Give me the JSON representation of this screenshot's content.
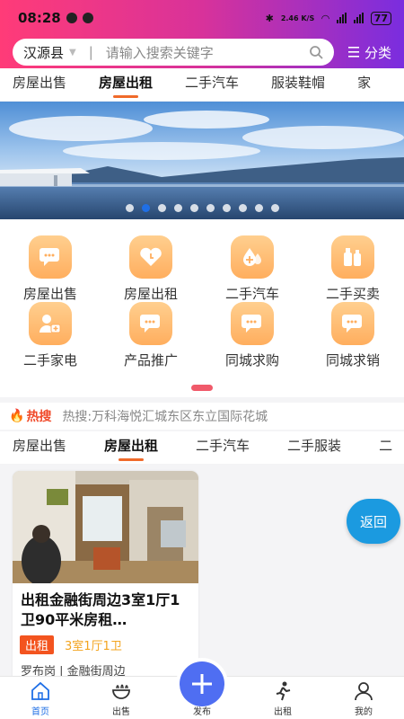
{
  "status_bar": {
    "time": "08:28",
    "network_speed": "2.46 K/S",
    "battery": "77"
  },
  "search": {
    "city": "汉源县",
    "placeholder": "请输入搜索关键字",
    "category_label": "分类"
  },
  "top_tabs": [
    {
      "label": "房屋出售",
      "active": false
    },
    {
      "label": "房屋出租",
      "active": true
    },
    {
      "label": "二手汽车",
      "active": false
    },
    {
      "label": "服装鞋帽",
      "active": false
    },
    {
      "label": "家",
      "active": false
    }
  ],
  "banner": {
    "dots": 10,
    "active_dot": 1
  },
  "grid": {
    "items": [
      {
        "label": "房屋出售",
        "icon": "chat-bubbles-icon"
      },
      {
        "label": "房屋出租",
        "icon": "heart-clock-icon"
      },
      {
        "label": "二手汽车",
        "icon": "droplet-plus-icon"
      },
      {
        "label": "二手买卖",
        "icon": "bottles-icon"
      },
      {
        "label": "二手家电",
        "icon": "person-medkit-icon"
      },
      {
        "label": "产品推广",
        "icon": "chat-bubbles-icon"
      },
      {
        "label": "同城求购",
        "icon": "chat-bubbles-icon"
      },
      {
        "label": "同城求销",
        "icon": "chat-bubbles-icon"
      }
    ]
  },
  "hot_search": {
    "label": "热搜",
    "text": "热搜:万科海悦汇城东区东立国际花城"
  },
  "content_tabs": [
    {
      "label": "房屋出售",
      "active": false
    },
    {
      "label": "房屋出租",
      "active": true
    },
    {
      "label": "二手汽车",
      "active": false
    },
    {
      "label": "二手服装",
      "active": false
    },
    {
      "label": "二",
      "active": false
    }
  ],
  "listing": {
    "title": "出租金融街周边3室1厅1卫90平米房租…",
    "tag": "出租",
    "rooms": "3室1厅1卫",
    "location": "罗布岗 | 金融街周边"
  },
  "back_button": "返回",
  "bottom_nav": {
    "home": "首页",
    "sell": "出售",
    "publish": "发布",
    "rent": "出租",
    "mine": "我的"
  },
  "colors": {
    "accent": "#f06a2a",
    "primary_blue": "#1f6fe6",
    "header_start": "#ff3b78",
    "header_end": "#7a2ddf"
  }
}
